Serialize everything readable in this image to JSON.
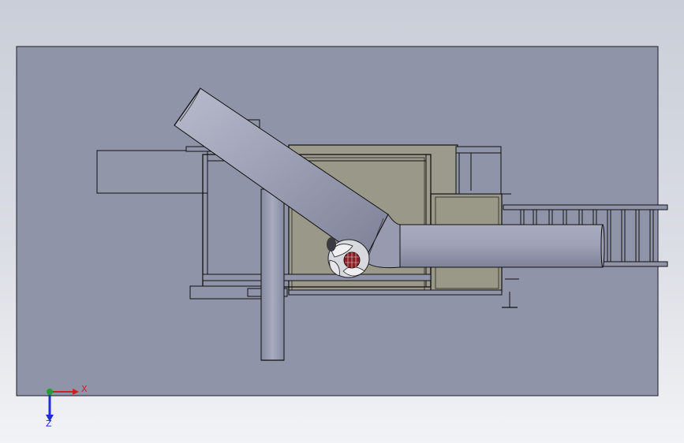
{
  "viewport": {
    "background_top": "#c9ced8",
    "background_bottom": "#f2f3f6",
    "plate_color": "#8f94a8",
    "pipe_color": "#9ea1b6",
    "panel_color": "#9c9a8c"
  },
  "triad": {
    "x_label": "X",
    "z_label": "Z",
    "x_color": "#cc2222",
    "z_color": "#1f2fd0",
    "origin_color": "#20a030"
  }
}
